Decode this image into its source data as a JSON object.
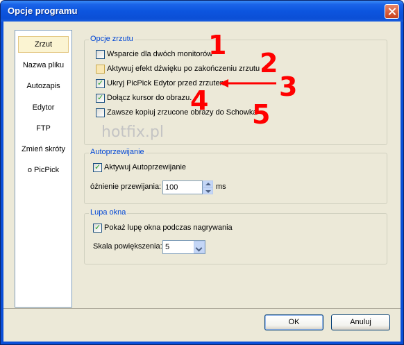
{
  "window": {
    "title": "Opcje programu"
  },
  "sidebar": {
    "items": [
      {
        "label": "Zrzut",
        "selected": true
      },
      {
        "label": "Nazwa pliku"
      },
      {
        "label": "Autozapis"
      },
      {
        "label": "Edytor"
      },
      {
        "label": "FTP"
      },
      {
        "label": "Zmień skróty"
      },
      {
        "label": "o PicPick"
      }
    ]
  },
  "capture_options": {
    "title": "Opcje zrzutu",
    "options": [
      {
        "label": "Wsparcie dla dwóch monitorów",
        "checked": false
      },
      {
        "label": "Aktywuj efekt dźwięku po zakończeniu zrzutu",
        "checked": false
      },
      {
        "label": "Ukryj PicPick Edytor przed zrzutem",
        "checked": true
      },
      {
        "label": "Dołącz kursor do obrazu.",
        "checked": true
      },
      {
        "label": "Zawsze kopiuj zrzucone obrazy do Schowka",
        "checked": false
      }
    ]
  },
  "preview": {
    "title": "Autoprzewijanie",
    "enable_label": "Aktywuj Autoprzewijanie",
    "enable_checked": true,
    "delay_label": "óźnienie przewijania:",
    "delay_value": "100",
    "delay_unit": "ms"
  },
  "magnifier": {
    "title": "Lupa okna",
    "show_label": "Pokaż lupę okna podczas nagrywania",
    "show_checked": true,
    "scale_label": "Skala powiększenia:",
    "scale_value": "5"
  },
  "buttons": {
    "ok": "OK",
    "cancel": "Anuluj"
  },
  "watermark": "hotfix.pl",
  "annotations": [
    "1",
    "2",
    "3",
    "4",
    "5"
  ],
  "colors": {
    "annotation": "#ff0000",
    "group_title": "#0046d5",
    "titlebar": "#0c55df"
  }
}
